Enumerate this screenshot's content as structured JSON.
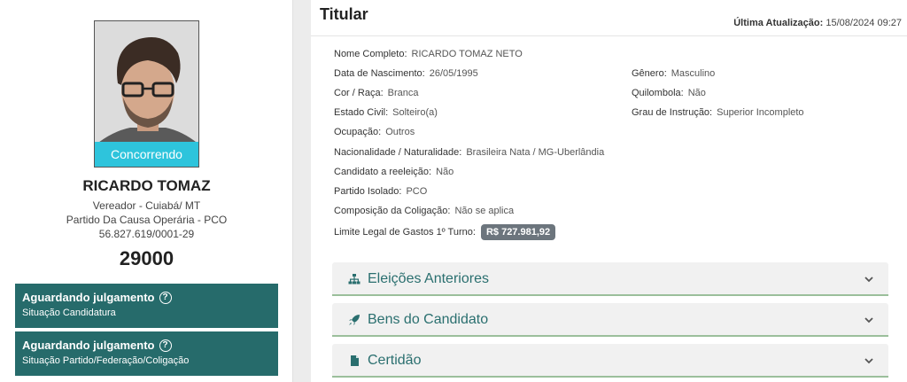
{
  "candidate": {
    "photo_badge": "Concorrendo",
    "name": "RICARDO TOMAZ",
    "office": "Vereador - Cuiabá/ MT",
    "party": "Partido Da Causa Operária - PCO",
    "cnpj": "56.827.619/0001-29",
    "number": "29000"
  },
  "status_cards": [
    {
      "title": "Aguardando julgamento",
      "subtitle": "Situação Candidatura",
      "icon": "question-circle-icon"
    },
    {
      "title": "Aguardando julgamento",
      "subtitle": "Situação Partido/Federação/Coligação",
      "icon": "question-circle-icon"
    }
  ],
  "titular": {
    "heading": "Titular",
    "updated_label": "Última Atualização:",
    "updated_value": "15/08/2024 09:27",
    "fields": {
      "nome_completo": {
        "label": "Nome Completo:",
        "value": "RICARDO TOMAZ NETO"
      },
      "data_nascimento": {
        "label": "Data de Nascimento:",
        "value": "26/05/1995"
      },
      "genero": {
        "label": "Gênero:",
        "value": "Masculino"
      },
      "cor_raca": {
        "label": "Cor / Raça:",
        "value": "Branca"
      },
      "quilombola": {
        "label": "Quilombola:",
        "value": "Não"
      },
      "estado_civil": {
        "label": "Estado Civil:",
        "value": "Solteiro(a)"
      },
      "grau_instrucao": {
        "label": "Grau de Instrução:",
        "value": "Superior Incompleto"
      },
      "ocupacao": {
        "label": "Ocupação:",
        "value": "Outros"
      },
      "nacionalidade": {
        "label": "Nacionalidade / Naturalidade:",
        "value": "Brasileira Nata / MG-Uberlândia"
      },
      "reeleicao": {
        "label": "Candidato a reeleição:",
        "value": "Não"
      },
      "partido_isolado": {
        "label": "Partido Isolado:",
        "value": "PCO"
      },
      "composicao": {
        "label": "Composição da Coligação:",
        "value": "Não se aplica"
      },
      "limite_gastos": {
        "label": "Limite Legal de Gastos 1º Turno:",
        "value": "R$ 727.981,92"
      }
    }
  },
  "accordions": [
    {
      "title": "Eleições Anteriores",
      "icon": "sitemap-icon"
    },
    {
      "title": "Bens do Candidato",
      "icon": "rocket-icon"
    },
    {
      "title": "Certidão",
      "icon": "file-icon"
    }
  ],
  "colors": {
    "status_card_bg": "#266b6b",
    "photo_badge_bg": "#2ec4dc",
    "accordion_title": "#2a6f6f",
    "money_badge_bg": "#6c757d"
  }
}
